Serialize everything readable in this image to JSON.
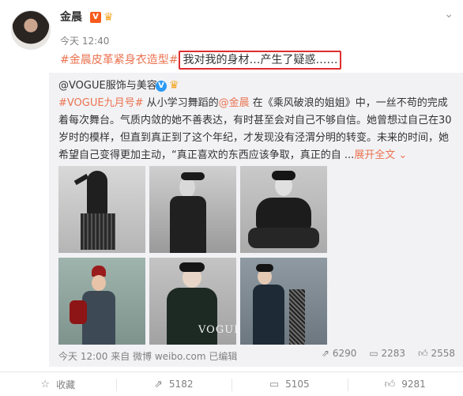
{
  "post": {
    "author": "金晨",
    "vip_badge": "V",
    "time": "今天 12:40",
    "tag": "#金晨皮革紧身衣造型#",
    "highlight_text": "我对我的身材…产生了疑惑……"
  },
  "repost": {
    "author": "@VOGUE服饰与美容",
    "verified_badge": "V",
    "text_tag": "#VOGUE九月号#",
    "text_1": " 从小学习舞蹈的",
    "mention": "@金晨",
    "text_2": " 在《乘风破浪的姐姐》中，一丝不苟的完成着每次舞台。气质内敛的她不善表达，有时甚至会对自己不够自信。她曾想过自己在30岁时的模样，但直到真正到了这个年纪，才发现没有泾渭分明的转变。未来的时间，她希望自己变得更加主动，“真正喜欢的东西应该争取，真正的自 ...",
    "expand_label": "展开全文",
    "expand_icon": "chevron-down",
    "footer": "今天 12:00 来自 微博 weibo.com 已编辑",
    "share_count": "6290",
    "comment_count": "2283",
    "like_count": "2558",
    "watermark": "VOGUE"
  },
  "actions": {
    "favorite_label": "收藏",
    "repost_count": "5182",
    "comment_count": "5105",
    "like_count": "9281"
  },
  "colors": {
    "tag": "#eb7350",
    "highlight_border": "#e02d2d",
    "repost_bg": "#f2f2f5",
    "verified_blue": "#2a9af5"
  }
}
